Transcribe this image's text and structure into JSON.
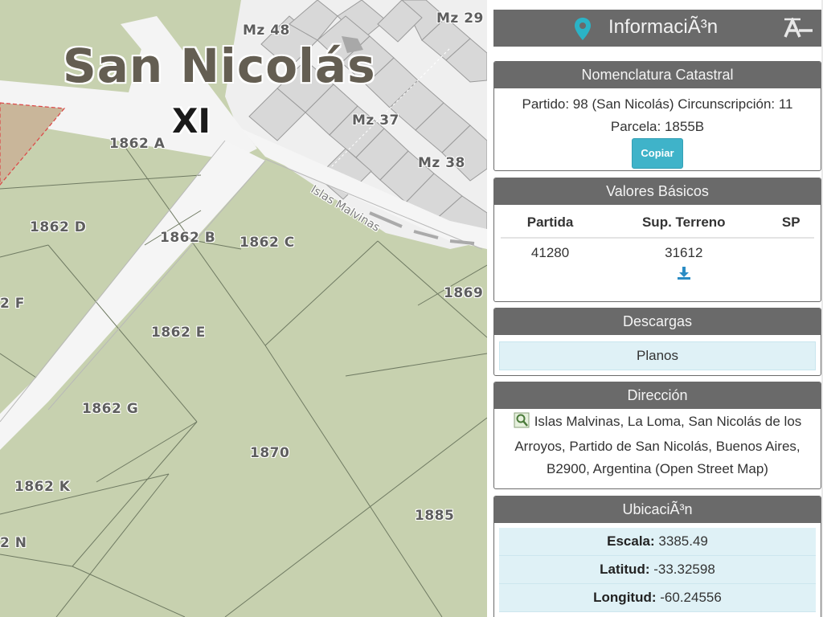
{
  "map": {
    "title": "San Nicolás",
    "section": "XI",
    "street": "Islas Malvinas",
    "blocks": [
      "Mz 48",
      "Mz 29",
      "Mz 37",
      "Mz 38"
    ],
    "parcels": [
      "1862 A",
      "1862 D",
      "1862 B",
      "1862 C",
      "2 F",
      "1862 E",
      "1869",
      "1862 G",
      "1870",
      "1862 K",
      "1885",
      "2 N"
    ]
  },
  "panel": {
    "title": "InformaciÃ³n",
    "pin_icon": "map-pin-icon",
    "collapse_icon": "collapse-icon",
    "accent_color": "#3fb3c9",
    "nomenclatura": {
      "heading": "Nomenclatura Catastral",
      "line1": "Partido: 98 (San Nicolás) Circunscripción: 11",
      "line2": "Parcela: 1855B",
      "copy_label": "Copiar"
    },
    "valores": {
      "heading": "Valores Básicos",
      "columns": [
        "Partida",
        "Sup. Terreno",
        "SP"
      ],
      "row": [
        "41280",
        "31612",
        ""
      ],
      "download_icon": "download-icon"
    },
    "descargas": {
      "heading": "Descargas",
      "planos_label": "Planos"
    },
    "direccion": {
      "heading": "Dirección",
      "text": "Islas Malvinas, La Loma, San Nicolás de los Arroyos, Partido de San Nicolás, Buenos Aires, B2900, Argentina (Open Street Map)",
      "search_icon": "search-map-icon"
    },
    "ubicacion": {
      "heading": "UbicaciÃ³n",
      "rows": [
        {
          "label": "Escala:",
          "value": "3385.49"
        },
        {
          "label": "Latitud:",
          "value": "-33.32598"
        },
        {
          "label": "Longitud:",
          "value": "-60.24556"
        }
      ]
    }
  }
}
